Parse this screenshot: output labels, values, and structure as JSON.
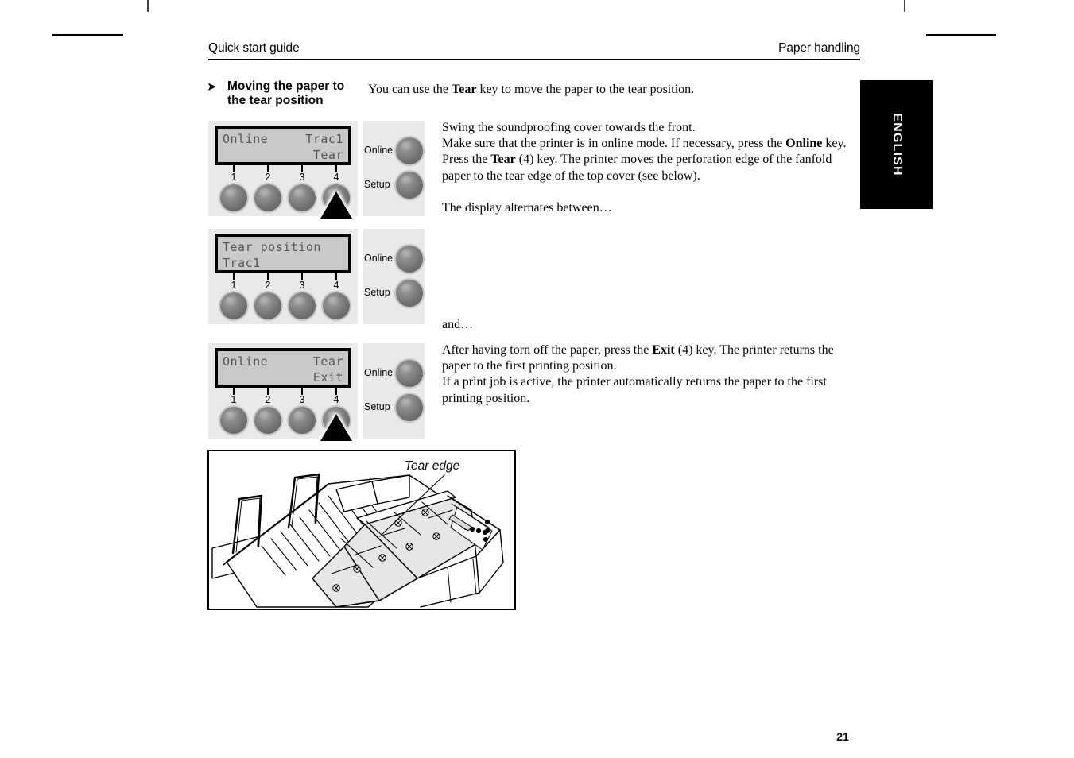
{
  "header": {
    "left": "Quick start guide",
    "right": "Paper handling"
  },
  "section": {
    "arrow_icon": "right-arrow-icon",
    "heading_line1": "Moving the paper to",
    "heading_line2": "the tear position",
    "intro_pre": "You can use the ",
    "intro_bold": "Tear",
    "intro_post": " key to move the paper to the tear position."
  },
  "steps": [
    {
      "panel": {
        "lcd": {
          "line1_left": "Online",
          "line1_right": "Trac1",
          "line2_left": "",
          "line2_right": "Tear"
        },
        "tick_numbers": [
          "1",
          "2",
          "3",
          "4"
        ],
        "highlight_button": 4,
        "side_buttons": [
          {
            "label": "Online",
            "name": "online-button"
          },
          {
            "label": "Setup",
            "name": "setup-button"
          }
        ]
      },
      "text_lines": [
        "Swing the soundproofing cover towards the front.",
        "Make sure that the printer is in online mode. If necessary, press the Online key.",
        "Press the Tear (4) key. The printer moves the perforation edge of the fanfold",
        "paper to the tear edge of the top cover (see below).",
        "",
        "The display alternates between…"
      ]
    },
    {
      "panel": {
        "lcd": {
          "line1_left": "Tear position",
          "line1_right": "",
          "line2_left": "Trac1",
          "line2_right": ""
        },
        "tick_numbers": [
          "1",
          "2",
          "3",
          "4"
        ],
        "highlight_button": 0,
        "side_buttons": [
          {
            "label": "Online",
            "name": "online-button"
          },
          {
            "label": "Setup",
            "name": "setup-button"
          }
        ]
      },
      "text_lines": [
        "and…"
      ]
    },
    {
      "panel": {
        "lcd": {
          "line1_left": "Online",
          "line1_right": "Tear",
          "line2_left": "",
          "line2_right": "Exit"
        },
        "tick_numbers": [
          "1",
          "2",
          "3",
          "4"
        ],
        "highlight_button": 4,
        "side_buttons": [
          {
            "label": "Online",
            "name": "online-button"
          },
          {
            "label": "Setup",
            "name": "setup-button"
          }
        ]
      },
      "text_lines": [
        "After having torn off the paper, press the Exit (4) key. The printer returns the",
        "paper to the first printing position.",
        "If a print job is active, the printer automatically returns the paper to the first",
        "printing position."
      ]
    }
  ],
  "body": {
    "p1_l1": "Swing the soundproofing cover towards the front.",
    "p1_l2a": "Make sure that the printer is in online mode. If necessary, press the ",
    "p1_l2b": "Online",
    "p1_l2c": " key.",
    "p1_l3a": "Press the ",
    "p1_l3b": "Tear",
    "p1_l3c": " (4) key. The printer moves the perforation edge of the fanfold",
    "p1_l4": "paper to the tear edge of the top cover (see below).",
    "p2": "The display alternates between…",
    "p3": "and…",
    "p4_l1a": "After having torn off the paper, press the ",
    "p4_l1b": "Exit",
    "p4_l1c": " (4) key. The printer returns the",
    "p4_l2": "paper to the first printing position.",
    "p4_l3": "If a print job is active, the printer automatically returns the paper to the first",
    "p4_l4": "printing position."
  },
  "thumb_tab": {
    "label": "ENGLISH"
  },
  "figure": {
    "caption": "Tear edge"
  },
  "page_number": "21",
  "colors": {
    "panel_bg": "#e9e9e9",
    "lcd_screen": "#c9c9c9",
    "lcd_text": "#555555",
    "button_gray": "#808080",
    "tab_black": "#000000",
    "page_bg": "#ffffff"
  }
}
